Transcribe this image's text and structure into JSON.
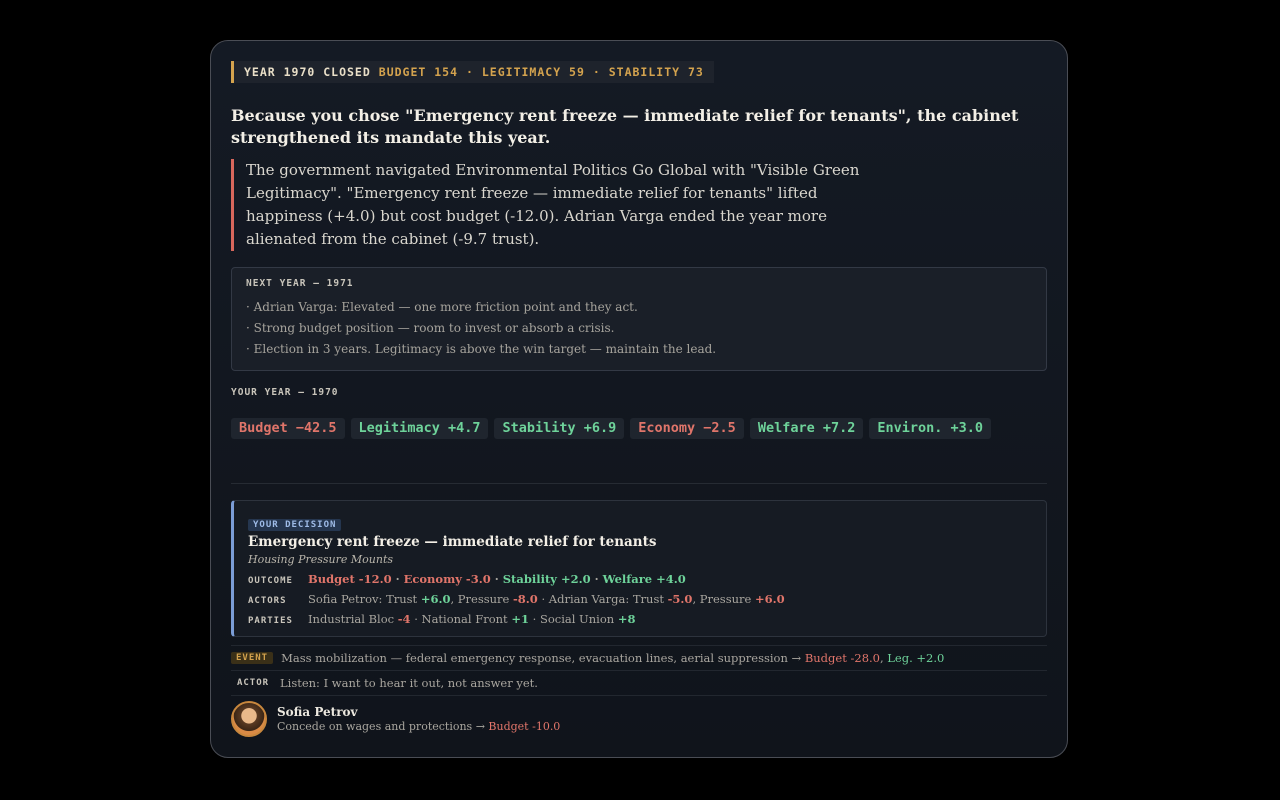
{
  "status": {
    "year_closed": "YEAR 1970 CLOSED",
    "budget": "BUDGET 154",
    "legitimacy": "· LEGITIMACY 59",
    "stability": "· STABILITY 73"
  },
  "headline": "Because you chose \"Emergency rent freeze — immediate relief for tenants\", the cabinet strengthened its mandate this year.",
  "narrative": "The government navigated Environmental Politics Go Global with \"Visible Green Legitimacy\". \"Emergency rent freeze — immediate relief for tenants\" lifted happiness (+4.0) but cost budget (-12.0). Adrian Varga ended the year more alienated from the cabinet (-9.7 trust).",
  "next_year": {
    "label": "NEXT YEAR — 1971",
    "items": [
      "· Adrian Varga: Elevated — one more friction point and they act.",
      "· Strong budget position — room to invest or absorb a crisis.",
      "· Election in 3 years. Legitimacy is above the win target — maintain the lead."
    ]
  },
  "your_year": {
    "label": "YOUR YEAR — 1970",
    "chips": [
      {
        "text": "Budget −42.5",
        "sign": "neg"
      },
      {
        "text": "Legitimacy +4.7",
        "sign": "pos"
      },
      {
        "text": "Stability +6.9",
        "sign": "pos"
      },
      {
        "text": "Economy −2.5",
        "sign": "neg"
      },
      {
        "text": "Welfare +7.2",
        "sign": "pos"
      },
      {
        "text": "Environ. +3.0",
        "sign": "pos"
      }
    ]
  },
  "decision": {
    "tag": "YOUR DECISION",
    "title": "Emergency rent freeze — immediate relief for tenants",
    "subtitle": "Housing Pressure Mounts",
    "outcome_label": "OUTCOME",
    "outcome": [
      {
        "text": "Budget -12.0",
        "sign": "neg"
      },
      {
        "text": "Economy -3.0",
        "sign": "neg"
      },
      {
        "text": "Stability +2.0",
        "sign": "pos"
      },
      {
        "text": "Welfare +4.0",
        "sign": "pos"
      }
    ],
    "actors_label": "ACTORS",
    "actors": {
      "a1": "Sofia Petrov: Trust",
      "a1_trust": "+6.0",
      "a1_pressure_label": ", Pressure",
      "a1_pressure": "-8.0",
      "a2": "· Adrian Varga: Trust",
      "a2_trust": "-5.0",
      "a2_pressure_label": ", Pressure",
      "a2_pressure": "+6.0"
    },
    "parties_label": "PARTIES",
    "parties": {
      "p1": "Industrial Bloc",
      "p1_val": "-4",
      "p2": "· National Front",
      "p2_val": "+1",
      "p3": "· Social Union",
      "p3_val": "+8"
    }
  },
  "event": {
    "tag": "EVENT",
    "text": "Mass mobilization — federal emergency response, evacuation lines, aerial suppression →",
    "effect1": "Budget -28.0",
    "sep": ",",
    "effect2": "Leg. +2.0"
  },
  "actor_row": {
    "tag": "ACTOR",
    "text": "Listen: I want to hear it out, not answer yet."
  },
  "person": {
    "name": "Sofia Petrov",
    "line": "Concede on wages and protections →",
    "effect": "Budget -10.0"
  },
  "colors": {
    "accent_gold": "#d4a34e",
    "negative": "#e0756a",
    "positive": "#6ed39a",
    "decision_blue": "#7b9dd6"
  }
}
